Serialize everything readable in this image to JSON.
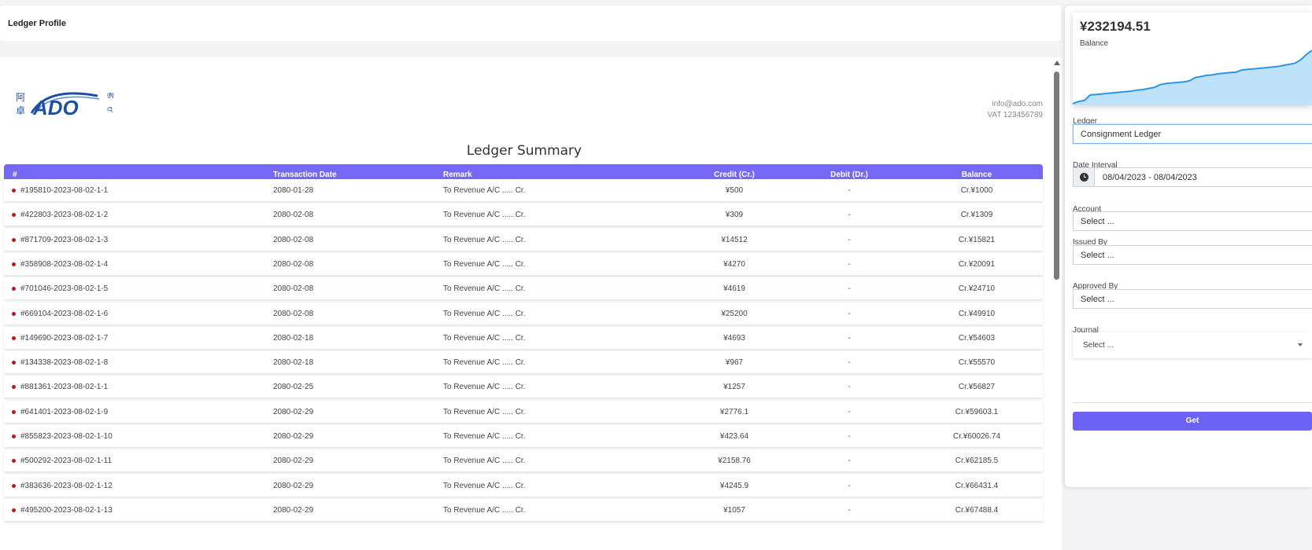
{
  "header": {
    "title": "Ledger Profile"
  },
  "company": {
    "email": "info@ado.com",
    "vat": "VAT 123456789",
    "logo_text": "ADO",
    "logo_cjk_left": [
      "阿",
      "卓"
    ],
    "logo_tibetan_right": [
      "ཨ",
      "འ"
    ]
  },
  "summary_title": "Ledger Summary",
  "table": {
    "columns": [
      "#",
      "Transaction Date",
      "Remark",
      "Credit (Cr.)",
      "Debit (Dr.)",
      "Balance"
    ],
    "rows": [
      {
        "id": "#195810-2023-08-02-1-1",
        "date": "2080-01-28",
        "remark": "To Revenue A/C ..... Cr.",
        "credit": "¥500",
        "debit": "-",
        "balance": "Cr.¥1000"
      },
      {
        "id": "#422803-2023-08-02-1-2",
        "date": "2080-02-08",
        "remark": "To Revenue A/C ..... Cr.",
        "credit": "¥309",
        "debit": "-",
        "balance": "Cr.¥1309"
      },
      {
        "id": "#871709-2023-08-02-1-3",
        "date": "2080-02-08",
        "remark": "To Revenue A/C ..... Cr.",
        "credit": "¥14512",
        "debit": "-",
        "balance": "Cr.¥15821"
      },
      {
        "id": "#358908-2023-08-02-1-4",
        "date": "2080-02-08",
        "remark": "To Revenue A/C ..... Cr.",
        "credit": "¥4270",
        "debit": "-",
        "balance": "Cr.¥20091"
      },
      {
        "id": "#701046-2023-08-02-1-5",
        "date": "2080-02-08",
        "remark": "To Revenue A/C ..... Cr.",
        "credit": "¥4619",
        "debit": "-",
        "balance": "Cr.¥24710"
      },
      {
        "id": "#669104-2023-08-02-1-6",
        "date": "2080-02-08",
        "remark": "To Revenue A/C ..... Cr.",
        "credit": "¥25200",
        "debit": "-",
        "balance": "Cr.¥49910"
      },
      {
        "id": "#149690-2023-08-02-1-7",
        "date": "2080-02-18",
        "remark": "To Revenue A/C ..... Cr.",
        "credit": "¥4693",
        "debit": "-",
        "balance": "Cr.¥54603"
      },
      {
        "id": "#134338-2023-08-02-1-8",
        "date": "2080-02-18",
        "remark": "To Revenue A/C ..... Cr.",
        "credit": "¥967",
        "debit": "-",
        "balance": "Cr.¥55570"
      },
      {
        "id": "#881361-2023-08-02-1-1",
        "date": "2080-02-25",
        "remark": "To Revenue A/C ..... Cr.",
        "credit": "¥1257",
        "debit": "-",
        "balance": "Cr.¥56827"
      },
      {
        "id": "#641401-2023-08-02-1-9",
        "date": "2080-02-29",
        "remark": "To Revenue A/C ..... Cr.",
        "credit": "¥2776.1",
        "debit": "-",
        "balance": "Cr.¥59603.1"
      },
      {
        "id": "#855823-2023-08-02-1-10",
        "date": "2080-02-29",
        "remark": "To Revenue A/C ..... Cr.",
        "credit": "¥423.64",
        "debit": "-",
        "balance": "Cr.¥60026.74"
      },
      {
        "id": "#500292-2023-08-02-1-11",
        "date": "2080-02-29",
        "remark": "To Revenue A/C ..... Cr.",
        "credit": "¥2158.76",
        "debit": "-",
        "balance": "Cr.¥62185.5"
      },
      {
        "id": "#383636-2023-08-02-1-12",
        "date": "2080-02-29",
        "remark": "To Revenue A/C ..... Cr.",
        "credit": "¥4245.9",
        "debit": "-",
        "balance": "Cr.¥66431.4"
      },
      {
        "id": "#495200-2023-08-02-1-13",
        "date": "2080-02-29",
        "remark": "To Revenue A/C ..... Cr.",
        "credit": "¥1057",
        "debit": "-",
        "balance": "Cr.¥67488.4"
      }
    ]
  },
  "panel": {
    "balance": "¥232194.51",
    "balance_label": "Balance",
    "ledger_label": "Ledger",
    "ledger_value": "Consignment Ledger",
    "date_label": "Date Interval",
    "date_value": "08/04/2023 - 08/04/2023",
    "account_label": "Account",
    "account_placeholder": "Select ...",
    "issued_label": "Issued By",
    "issued_placeholder": "Select ...",
    "approved_label": "Approved By",
    "approved_placeholder": "Select ...",
    "journal_label": "Journal",
    "journal_value": "Select ...",
    "get_label": "Get"
  },
  "sparkline": {
    "values": [
      0,
      4,
      6,
      16,
      17,
      18,
      19,
      20,
      21,
      22,
      23,
      25,
      26,
      28,
      30,
      35,
      37,
      38,
      39,
      40,
      42,
      48,
      50,
      52,
      53,
      55,
      56,
      57,
      58,
      62,
      63,
      64,
      65,
      66,
      67,
      68,
      70,
      72,
      74,
      80,
      90,
      98
    ],
    "color": "#2e94e6",
    "fill": "#bfe2fb"
  },
  "colors": {
    "accent": "#7468f4",
    "button": "#6c63f5",
    "dot": "#c0141e"
  }
}
